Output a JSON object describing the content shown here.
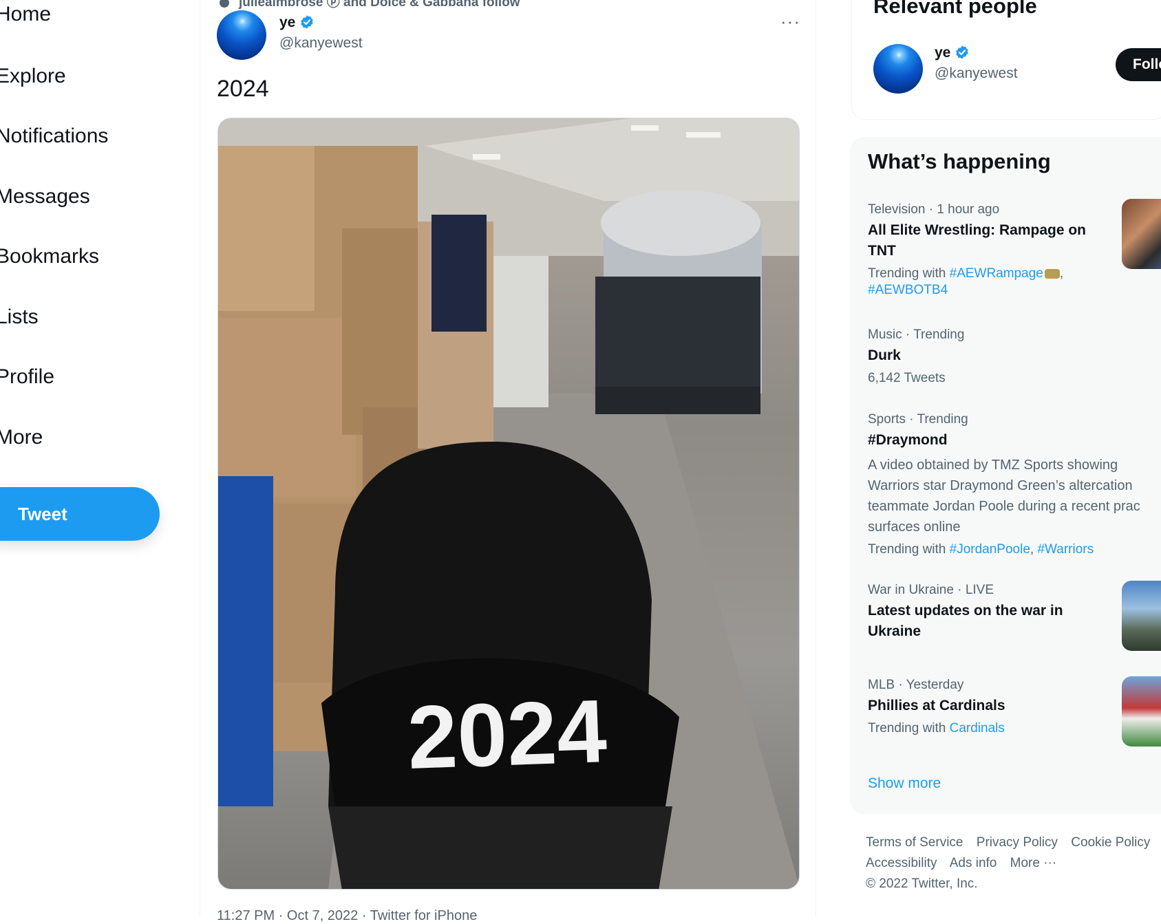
{
  "nav": {
    "items": [
      "Home",
      "Explore",
      "Notifications",
      "Messages",
      "Bookmarks",
      "Lists",
      "Profile",
      "More"
    ],
    "tweet_button": "Tweet"
  },
  "tweet": {
    "social_context": "juliealmbrose ⓟ and Dolce & Gabbana follow",
    "name": "ye",
    "handle": "@kanyewest",
    "text": "2024",
    "more": "···",
    "media_hat_text": "2024",
    "meta": "11:27 PM · Oct 7, 2022 · Twitter for iPhone"
  },
  "relevant_people": {
    "title": "Relevant people",
    "name": "ye",
    "handle": "@kanyewest",
    "follow_label": "Follow"
  },
  "whats_happening": {
    "title": "What’s happening",
    "trends": [
      {
        "meta": "Television · 1 hour ago",
        "title_lines": [
          "All Elite Wrestling: Rampage on",
          "TNT"
        ],
        "sub_prefix": "Trending with",
        "links": [
          "#AEWRampage",
          "#AEWBOTB4"
        ]
      },
      {
        "meta": "Music · Trending",
        "title": "Durk",
        "sub": "6,142 Tweets"
      },
      {
        "meta": "Sports · Trending",
        "title": "#Draymond",
        "desc_lines": [
          "A video obtained by TMZ Sports showing",
          "Warriors star Draymond Green’s altercation",
          "teammate Jordan Poole during a recent prac",
          "surfaces online"
        ],
        "sub_prefix": "Trending with",
        "links": [
          "#JordanPoole",
          "#Warriors"
        ]
      },
      {
        "meta": "War in Ukraine · LIVE",
        "title_lines": [
          "Latest updates on the war in",
          "Ukraine"
        ]
      },
      {
        "meta": "MLB · Yesterday",
        "title": "Phillies at Cardinals",
        "sub_prefix": "Trending with",
        "links": [
          "Cardinals"
        ]
      }
    ],
    "show_more": "Show more"
  },
  "footer": {
    "links": [
      "Terms of Service",
      "Privacy Policy",
      "Cookie Policy",
      "Accessibility",
      "Ads info",
      "More ···"
    ],
    "copyright": "© 2022 Twitter, Inc."
  },
  "colors": {
    "accent": "#1d9bf0",
    "text": "#0f1419",
    "secondary": "#536471",
    "panel": "#f7f9f9"
  }
}
